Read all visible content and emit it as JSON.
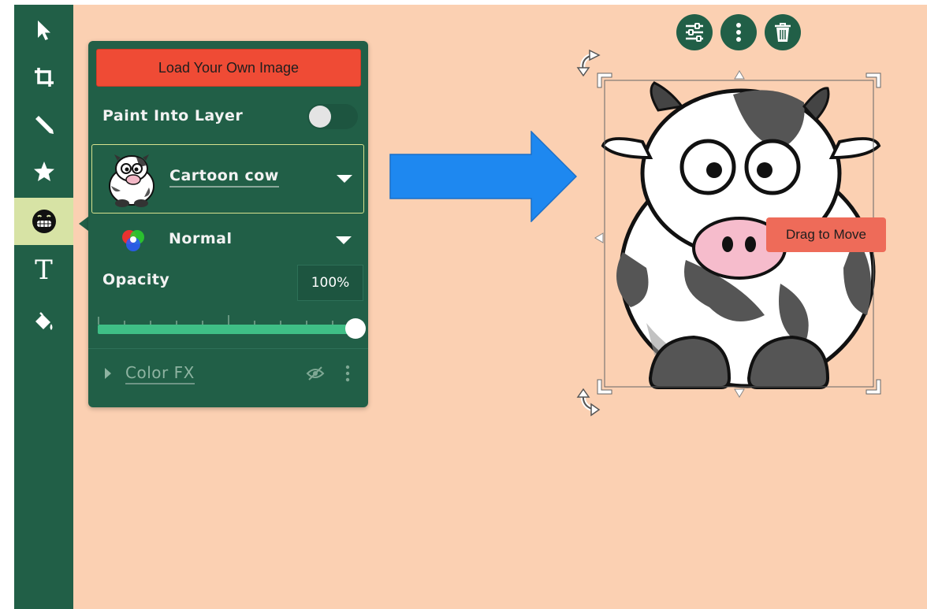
{
  "sidebar": {
    "tools": [
      {
        "name": "select-tool",
        "icon": "arrow-cursor-icon"
      },
      {
        "name": "crop-tool",
        "icon": "crop-icon"
      },
      {
        "name": "draw-tool",
        "icon": "pencil-icon"
      },
      {
        "name": "shapes-tool",
        "icon": "star-icon"
      },
      {
        "name": "stickers-tool",
        "icon": "grin-emoji-icon",
        "active": true
      },
      {
        "name": "text-tool",
        "icon": "text-icon",
        "label": "T"
      },
      {
        "name": "fill-tool",
        "icon": "paint-bucket-icon"
      }
    ]
  },
  "panel": {
    "load_button": "Load Your Own Image",
    "paint_into_layer": "Paint Into Layer",
    "paint_into_layer_on": false,
    "sticker_name": "Cartoon cow",
    "blend_mode": "Normal",
    "opacity_label": "Opacity",
    "opacity_value": "100%",
    "opacity_fraction": 1.0,
    "color_fx_label": "Color FX"
  },
  "canvas": {
    "tooltip": "Drag to Move",
    "selection_buttons": [
      "sliders-icon",
      "more-vertical-icon",
      "trash-icon"
    ]
  },
  "colors": {
    "sidebar": "#215f47",
    "canvas": "#fbd0b2",
    "load_button": "#ef4b35",
    "slider": "#3fbf86",
    "arrow": "#1e88f0",
    "tooltip": "#ee6b59"
  }
}
